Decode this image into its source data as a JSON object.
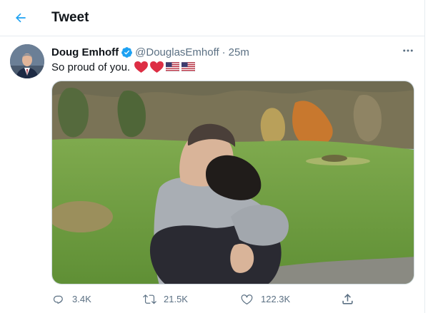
{
  "header": {
    "title": "Tweet",
    "back_icon": "arrow-left-icon"
  },
  "colors": {
    "accent": "#1da1f2",
    "secondary_text": "#5b7083",
    "heart": "#e0245e"
  },
  "tweet": {
    "display_name": "Doug Emhoff",
    "verified_icon": "verified-badge-icon",
    "handle": "@DouglasEmhoff",
    "separator": "·",
    "time": "25m",
    "text": "So proud of you.",
    "emojis": [
      "red-heart",
      "red-heart",
      "us-flag",
      "us-flag"
    ],
    "more_icon": "more-dots-icon"
  },
  "actions": {
    "reply_count": "3.4K",
    "retweet_count": "21.5K",
    "like_count": "122.3K",
    "share_icon": "share-icon"
  }
}
